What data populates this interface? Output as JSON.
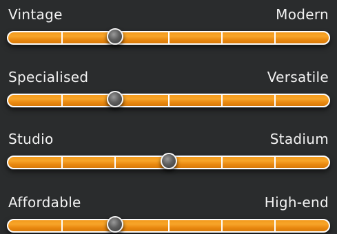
{
  "sliders": [
    {
      "left_label": "Vintage",
      "right_label": "Modern",
      "value": 0.333
    },
    {
      "left_label": "Specialised",
      "right_label": "Versatile",
      "value": 0.333
    },
    {
      "left_label": "Studio",
      "right_label": "Stadium",
      "value": 0.5
    },
    {
      "left_label": "Affordable",
      "right_label": "High-end",
      "value": 0.333
    }
  ],
  "colors": {
    "background": "#2a2c2d",
    "track_fill": "#f39a1c",
    "track_border": "#fdfdfd",
    "knob": "#5e5e5e",
    "text": "#f2f2f2"
  },
  "tick_positions": [
    0.1667,
    0.3333,
    0.5,
    0.6667,
    0.8333
  ]
}
